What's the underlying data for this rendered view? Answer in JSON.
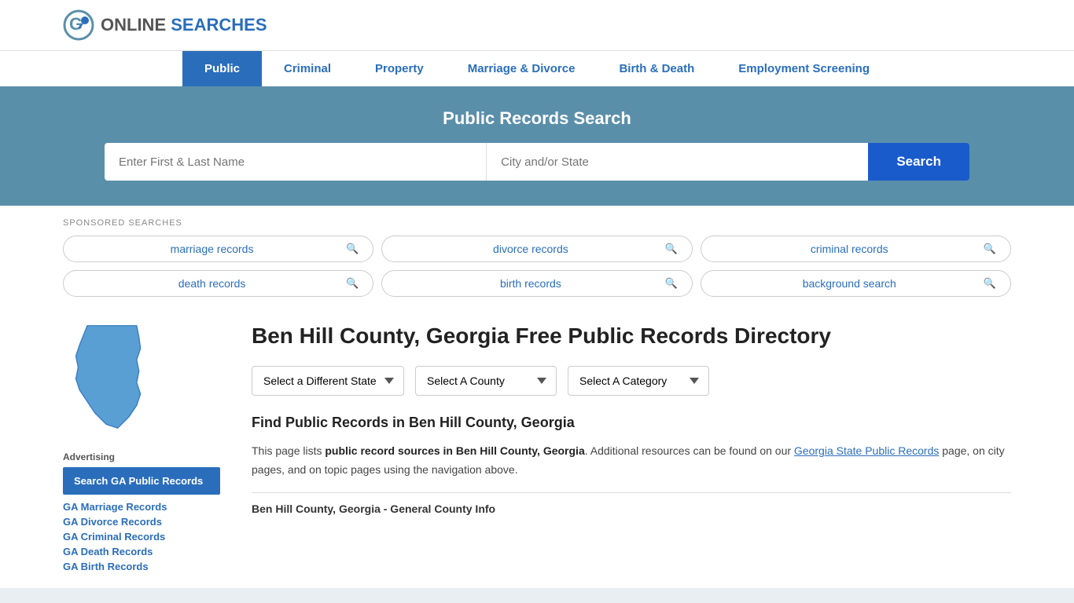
{
  "header": {
    "logo_text_online": "ONLINE",
    "logo_text_searches": "SEARCHES"
  },
  "nav": {
    "items": [
      {
        "label": "Public",
        "active": true
      },
      {
        "label": "Criminal",
        "active": false
      },
      {
        "label": "Property",
        "active": false
      },
      {
        "label": "Marriage & Divorce",
        "active": false
      },
      {
        "label": "Birth & Death",
        "active": false
      },
      {
        "label": "Employment Screening",
        "active": false
      }
    ]
  },
  "hero": {
    "title": "Public Records Search",
    "name_placeholder": "Enter First & Last Name",
    "location_placeholder": "City and/or State",
    "search_button": "Search"
  },
  "sponsored": {
    "label": "SPONSORED SEARCHES",
    "items": [
      "marriage records",
      "divorce records",
      "criminal records",
      "death records",
      "birth records",
      "background search"
    ]
  },
  "sidebar": {
    "advertising_label": "Advertising",
    "ad_box_text": "Search GA Public Records",
    "links": [
      "GA Marriage Records",
      "GA Divorce Records",
      "GA Criminal Records",
      "GA Death Records",
      "GA Birth Records"
    ]
  },
  "content": {
    "page_title": "Ben Hill County, Georgia Free Public Records Directory",
    "dropdowns": {
      "state": "Select a Different State",
      "county": "Select A County",
      "category": "Select A Category"
    },
    "find_title": "Find Public Records in Ben Hill County, Georgia",
    "description": "This page lists public record sources in Ben Hill County, Georgia. Additional resources can be found on our Georgia State Public Records page, on city pages, and on topic pages using the navigation above.",
    "county_info_title": "Ben Hill County, Georgia - General County Info"
  }
}
